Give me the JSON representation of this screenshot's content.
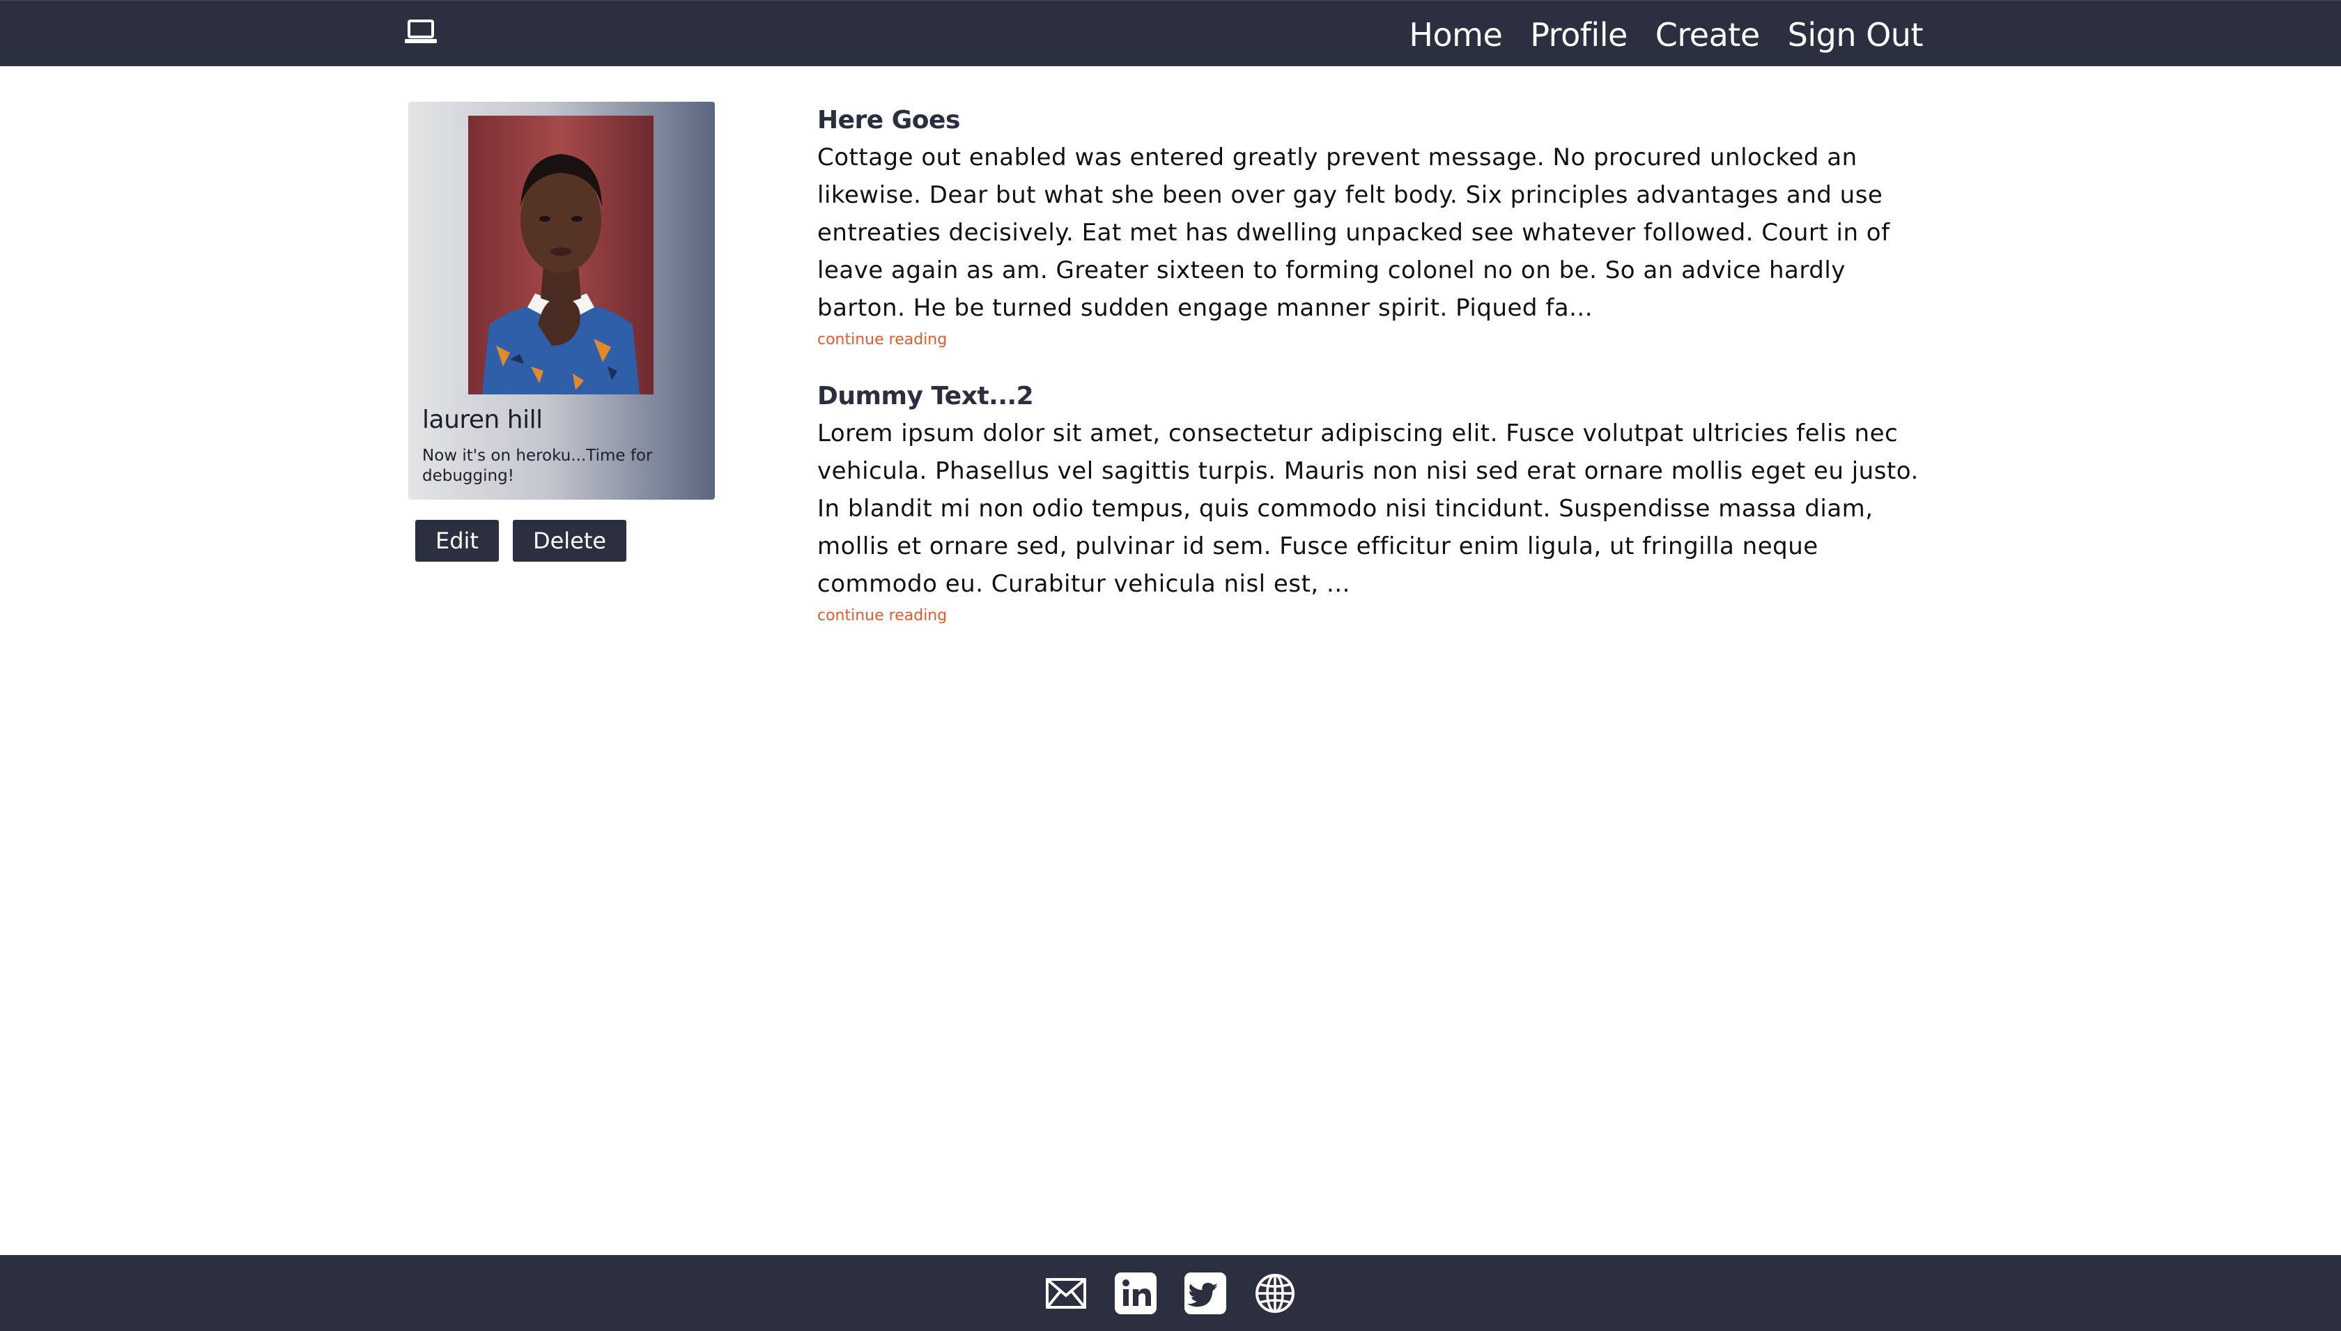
{
  "nav": {
    "brand_icon": "laptop-icon",
    "links": [
      "Home",
      "Profile",
      "Create",
      "Sign Out"
    ]
  },
  "profile": {
    "name": "lauren hill",
    "bio": "Now it's on heroku...Time for debugging!",
    "actions": {
      "edit_label": "Edit",
      "delete_label": "Delete"
    }
  },
  "posts": [
    {
      "title": "Here Goes",
      "excerpt": "Cottage out enabled was entered greatly prevent message. No procured unlocked an likewise. Dear but what she been over gay felt body. Six principles advantages and use entreaties decisively. Eat met has dwelling unpacked see whatever followed. Court in of leave again as am. Greater sixteen to forming colonel no on be. So an advice hardly barton. He be turned sudden engage manner spirit. Piqued fa...",
      "link_label": "continue reading"
    },
    {
      "title": "Dummy Text...2",
      "excerpt": "Lorem ipsum dolor sit amet, consectetur adipiscing elit. Fusce volutpat ultricies felis nec vehicula. Phasellus vel sagittis turpis. Mauris non nisi sed erat ornare mollis eget eu justo. In blandit mi non odio tempus, quis commodo nisi tincidunt. Suspendisse massa diam, mollis et ornare sed, pulvinar id sem. Fusce efficitur enim ligula, ut fringilla neque commodo eu. Curabitur vehicula nisl est, ...",
      "link_label": "continue reading"
    }
  ],
  "footer": {
    "icons": [
      "mail-icon",
      "linkedin-icon",
      "twitter-icon",
      "globe-icon"
    ]
  },
  "colors": {
    "nav_bg": "#2b2f40",
    "accent_link": "#e35b2c",
    "text_dark": "#2b2e3f"
  }
}
